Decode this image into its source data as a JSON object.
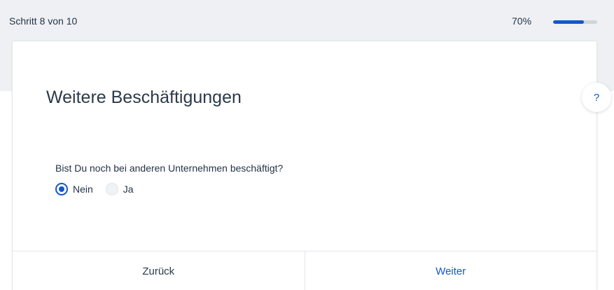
{
  "header": {
    "step_label": "Schritt 8 von 10",
    "progress_text": "70%",
    "progress_value": 0.7
  },
  "card": {
    "title": "Weitere Beschäftigungen",
    "question": "Bist Du noch bei anderen Unternehmen beschäftigt?",
    "options": [
      {
        "label": "Nein",
        "checked": true
      },
      {
        "label": "Ja",
        "checked": false
      }
    ],
    "footer": {
      "back_label": "Zurück",
      "next_label": "Weiter"
    }
  },
  "help": {
    "label": "?"
  },
  "colors": {
    "accent": "#1257c9",
    "background_band": "#eef0f3"
  }
}
